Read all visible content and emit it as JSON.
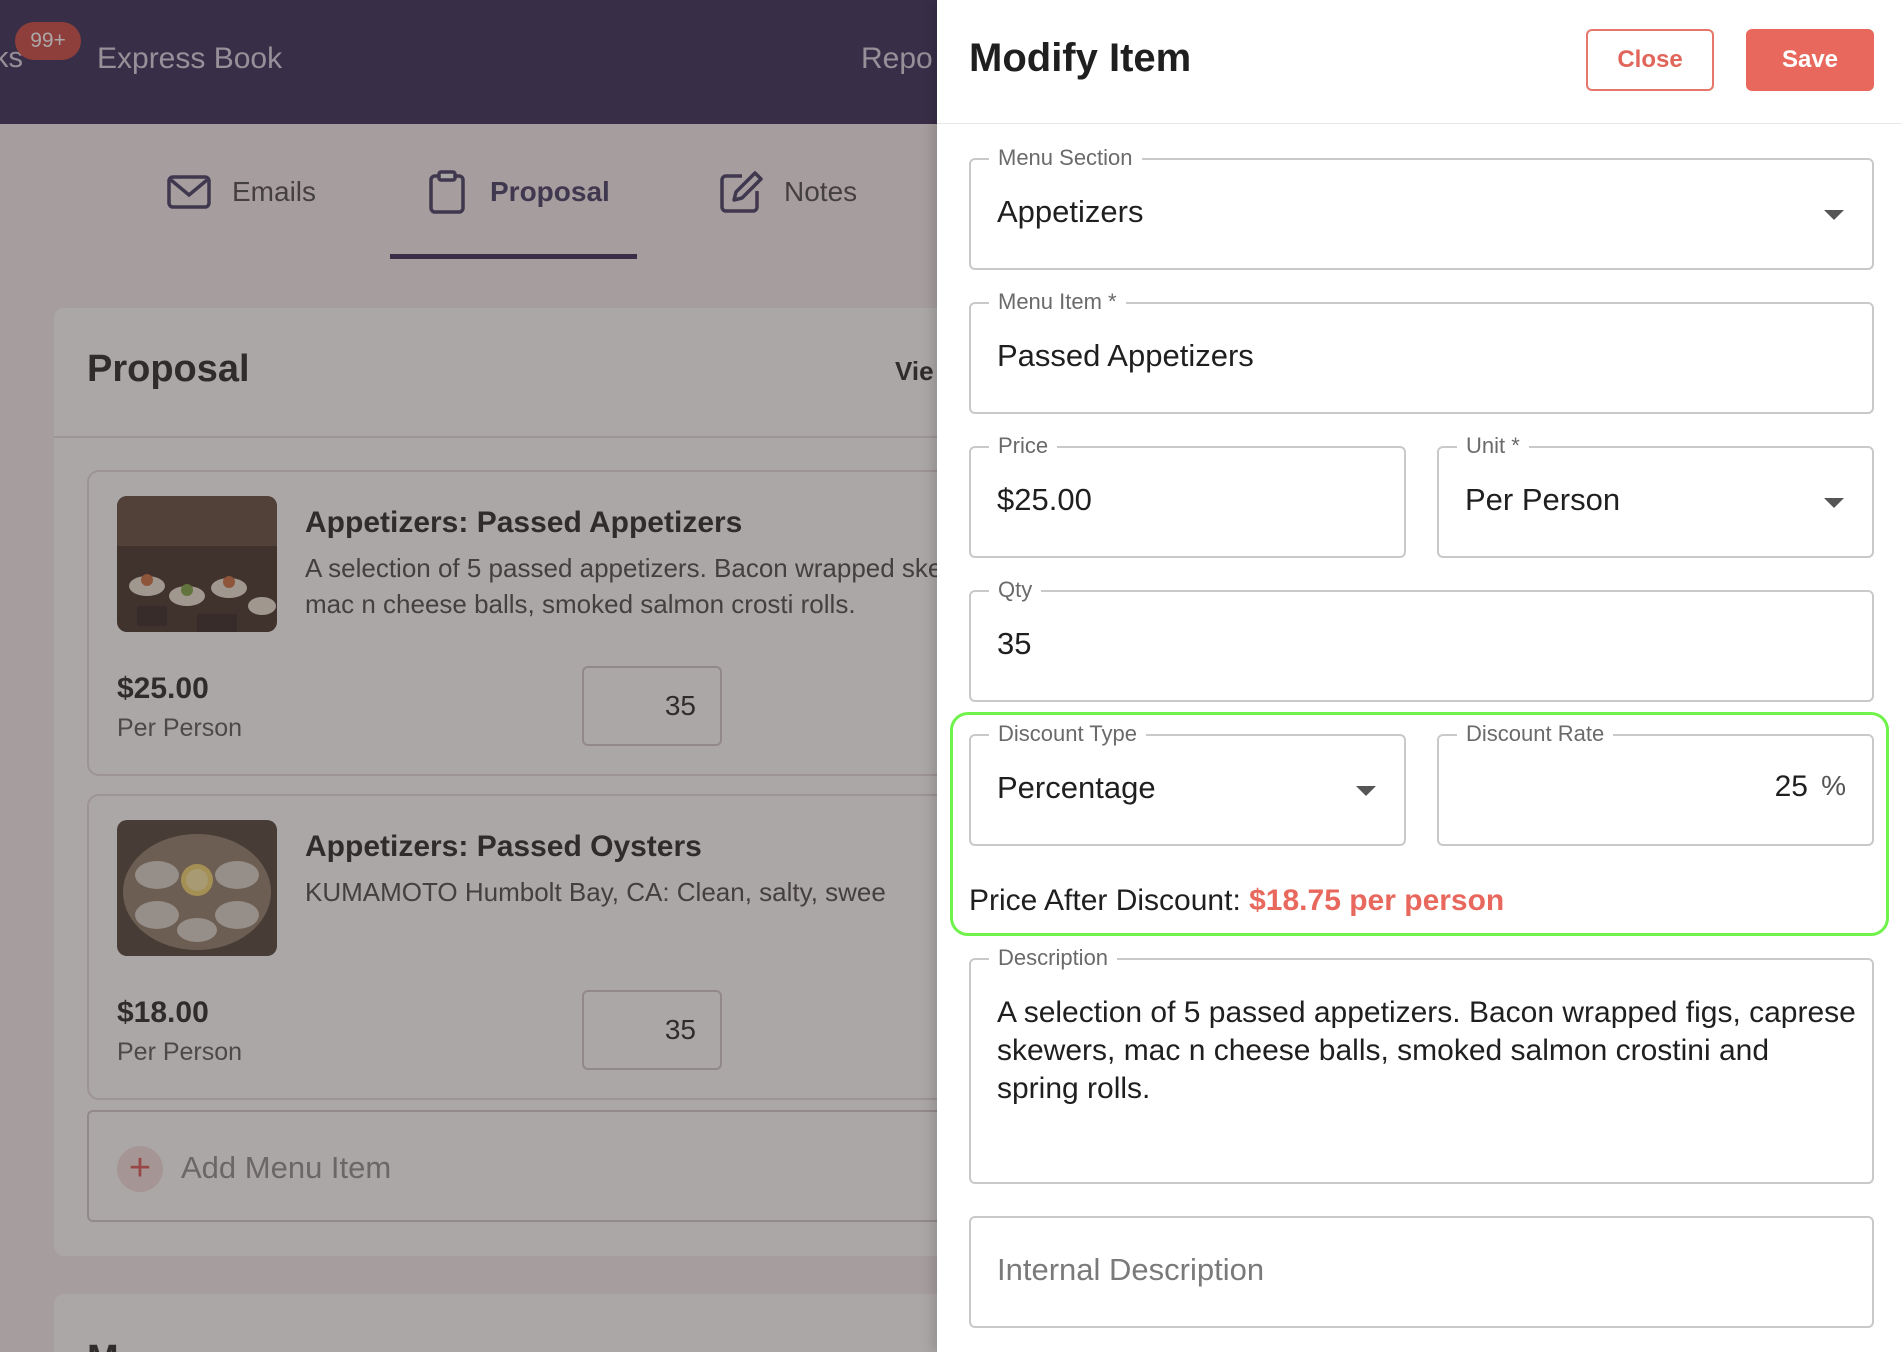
{
  "background": {
    "topbar": {
      "cut_text": "ks",
      "badge": "99+",
      "nav_express": "Express Book",
      "nav_reports": "Repo"
    },
    "tabs": [
      {
        "label": "Emails",
        "icon": "envelope-icon"
      },
      {
        "label": "Proposal",
        "icon": "clipboard-icon",
        "active": true
      },
      {
        "label": "Notes",
        "icon": "edit-note-icon"
      }
    ],
    "proposal": {
      "title": "Proposal",
      "view_link": "Vie",
      "items": [
        {
          "title": "Appetizers: Passed Appetizers",
          "description": "A selection of 5 passed appetizers. Bacon wrapped skewers, mac n cheese balls, smoked salmon crosti rolls.",
          "price": "$25.00",
          "unit": "Per Person",
          "qty": "35"
        },
        {
          "title": "Appetizers: Passed Oysters",
          "description": "KUMAMOTO Humbolt Bay, CA: Clean, salty, swee",
          "price": "$18.00",
          "unit": "Per Person",
          "qty": "35"
        }
      ],
      "add_item_label": "Add Menu Item",
      "second_card_peek": "M"
    }
  },
  "drawer": {
    "title": "Modify Item",
    "close_label": "Close",
    "save_label": "Save",
    "menu_section": {
      "label": "Menu Section",
      "value": "Appetizers"
    },
    "menu_item": {
      "label": "Menu Item *",
      "value": "Passed Appetizers"
    },
    "price": {
      "label": "Price",
      "value": "$25.00"
    },
    "unit": {
      "label": "Unit *",
      "value": "Per Person"
    },
    "qty": {
      "label": "Qty",
      "value": "35"
    },
    "discount_type": {
      "label": "Discount Type",
      "value": "Percentage"
    },
    "discount_rate": {
      "label": "Discount Rate",
      "value": "25",
      "suffix": "%"
    },
    "price_after_discount": {
      "label": "Price After Discount:",
      "value": "$18.75 per person"
    },
    "description": {
      "label": "Description",
      "value": "A selection of 5 passed appetizers. Bacon wrapped figs, caprese skewers, mac n cheese balls, smoked salmon crostini and spring rolls."
    },
    "internal_description": {
      "placeholder": "Internal Description"
    }
  },
  "colors": {
    "topbar": "#2c2451",
    "accent": "#e8685d",
    "highlight": "#6ff24a",
    "badge": "#c8403b"
  }
}
